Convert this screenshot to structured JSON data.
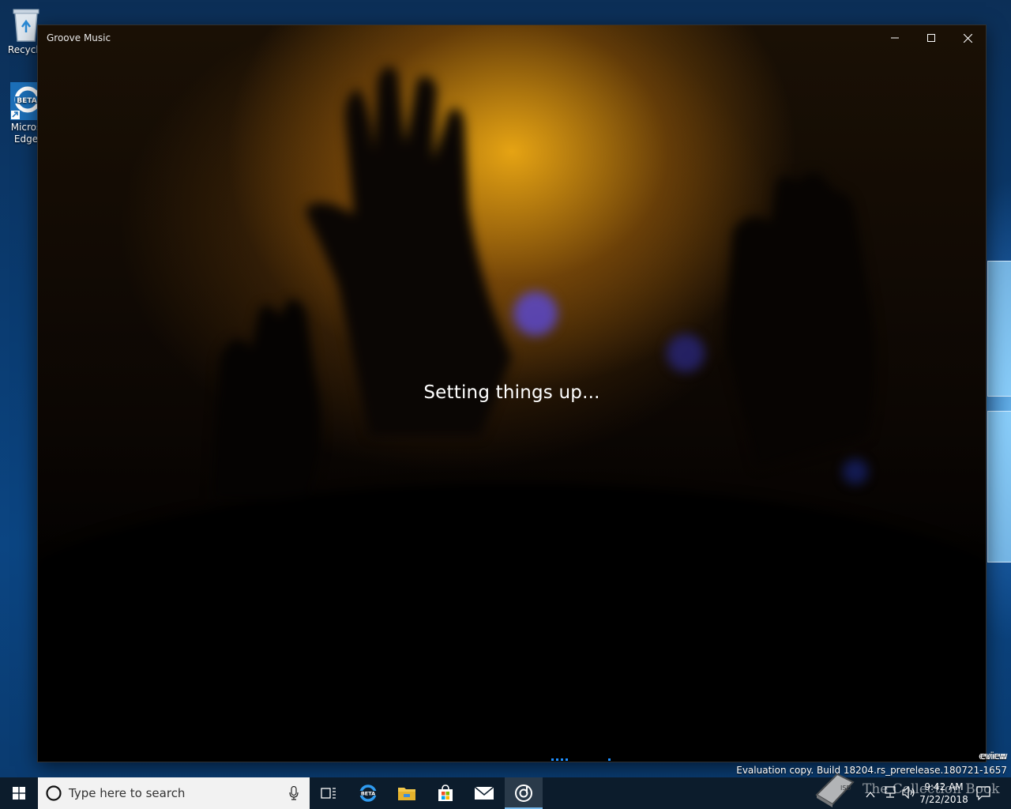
{
  "desktop": {
    "icons": [
      {
        "label": "Recycle",
        "icon": "recycle-bin-icon"
      },
      {
        "label": "Micros\nEdge",
        "icon": "edge-beta-icon"
      }
    ]
  },
  "window": {
    "title": "Groove Music",
    "status": "Setting things up...",
    "controls": {
      "minimize": "minimize-icon",
      "maximize": "maximize-icon",
      "close": "close-icon"
    }
  },
  "watermark": {
    "line1": "eview",
    "line2": "Evaluation copy. Build 18204.rs_prerelease.180721-1657"
  },
  "taskbar": {
    "search_placeholder": "Type here to search",
    "apps": [
      "task-view-icon",
      "edge-beta-icon",
      "file-explorer-icon",
      "store-icon",
      "mail-icon",
      "groove-music-icon"
    ],
    "active_app": "groove-music-icon",
    "overlay_text": "The Collection Book",
    "time": "9:42 AM",
    "date": "7/22/2018"
  },
  "colors": {
    "accent": "#76b9ed",
    "taskbar": "#0c1c2c",
    "progress": "#1e90ff"
  }
}
